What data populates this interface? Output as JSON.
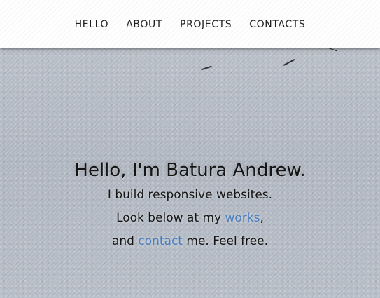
{
  "nav": {
    "items": [
      {
        "label": "HELLO"
      },
      {
        "label": "ABOUT"
      },
      {
        "label": "PROJECTS"
      },
      {
        "label": "CONTACTS"
      }
    ]
  },
  "hero": {
    "title": "Hello, I'm Batura Andrew.",
    "line1": "I build responsive websites.",
    "line2_prefix": "Look below at my ",
    "line2_link": "works",
    "line2_suffix": ",",
    "line3_prefix": "and ",
    "line3_link": "contact",
    "line3_suffix": " me. Feel free."
  },
  "colors": {
    "link": "#4a7ec0",
    "background": "#b8bfc8",
    "navbar": "#ffffff"
  }
}
